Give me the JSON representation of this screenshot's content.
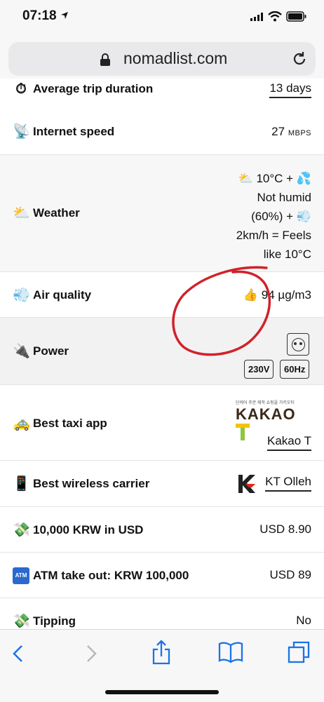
{
  "status_bar": {
    "time": "07:18"
  },
  "browser": {
    "url": "nomadlist.com"
  },
  "rows": [
    {
      "label": "Average trip duration",
      "value": "13 days"
    },
    {
      "label": "Internet speed",
      "value": "27",
      "unit": "MBPS"
    },
    {
      "label": "Weather",
      "value_lines": [
        "10°C +",
        "Not humid",
        "(60%) +",
        "2km/h = Feels",
        "like 10°C"
      ]
    },
    {
      "label": "Air quality",
      "value": "94 µg/m3"
    },
    {
      "label": "Power",
      "badges": [
        "230V",
        "60Hz"
      ]
    },
    {
      "label": "Best taxi app",
      "logo_text": "KAKAO",
      "logo_subtext": "단케어 주문 제작 쇼핑을 가키오티",
      "value": "Kakao T"
    },
    {
      "label": "Best wireless carrier",
      "value": "KT Olleh"
    },
    {
      "label": "10,000 KRW in USD",
      "value": "USD 8.90"
    },
    {
      "label": "ATM take out: KRW 100,000",
      "value": "USD 89"
    },
    {
      "label": "Tipping",
      "value": "No"
    }
  ],
  "icons": {
    "trip": "stopwatch-icon",
    "internet": "satellite-dish-icon",
    "weather": "sun-behind-cloud-icon",
    "air": "wind-icon",
    "power": "electric-plug-icon",
    "taxi": "taxi-icon",
    "carrier": "mobile-phone-icon",
    "money": "money-with-wings-icon",
    "atm": "atm-icon",
    "thumbs": "thumbs-up-icon",
    "socket": "power-socket-icon"
  },
  "colors": {
    "annotation": "#d0222a",
    "toolbar_icons": "#1a73e8",
    "kakao_yellow": "#f5c400",
    "kakao_green": "#8dc63f"
  }
}
